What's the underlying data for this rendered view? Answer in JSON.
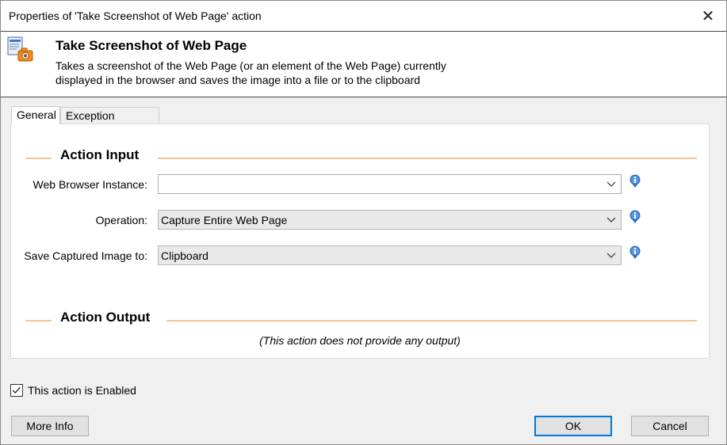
{
  "window": {
    "title": "Properties of 'Take Screenshot of Web Page' action",
    "close_symbol": "✕"
  },
  "header": {
    "title": "Take Screenshot of Web Page",
    "description_line1": "Takes a screenshot of the Web Page (or an element of the Web Page) currently",
    "description_line2": "displayed in the browser and saves the image into a file or to the clipboard",
    "icon": "web-page-camera-icon"
  },
  "tabs": [
    {
      "label": "General",
      "active": true
    },
    {
      "label": "Exception Handling",
      "active": false
    }
  ],
  "action_input": {
    "title": "Action Input",
    "fields": [
      {
        "label": "Web Browser Instance:",
        "value": "",
        "icon": "info-icon"
      },
      {
        "label": "Operation:",
        "value": "Capture Entire Web Page",
        "icon": "info-icon"
      },
      {
        "label": "Save Captured Image to:",
        "value": "Clipboard",
        "icon": "info-icon"
      }
    ]
  },
  "action_output": {
    "title": "Action Output",
    "message": "(This action does not provide any output)"
  },
  "footer": {
    "enabled_label": "This action is Enabled",
    "enabled_checked": true,
    "more_info_label": "More Info",
    "ok_label": "OK",
    "cancel_label": "Cancel"
  },
  "colors": {
    "section_line": "#f5c593",
    "default_button_border": "#0078d7"
  }
}
